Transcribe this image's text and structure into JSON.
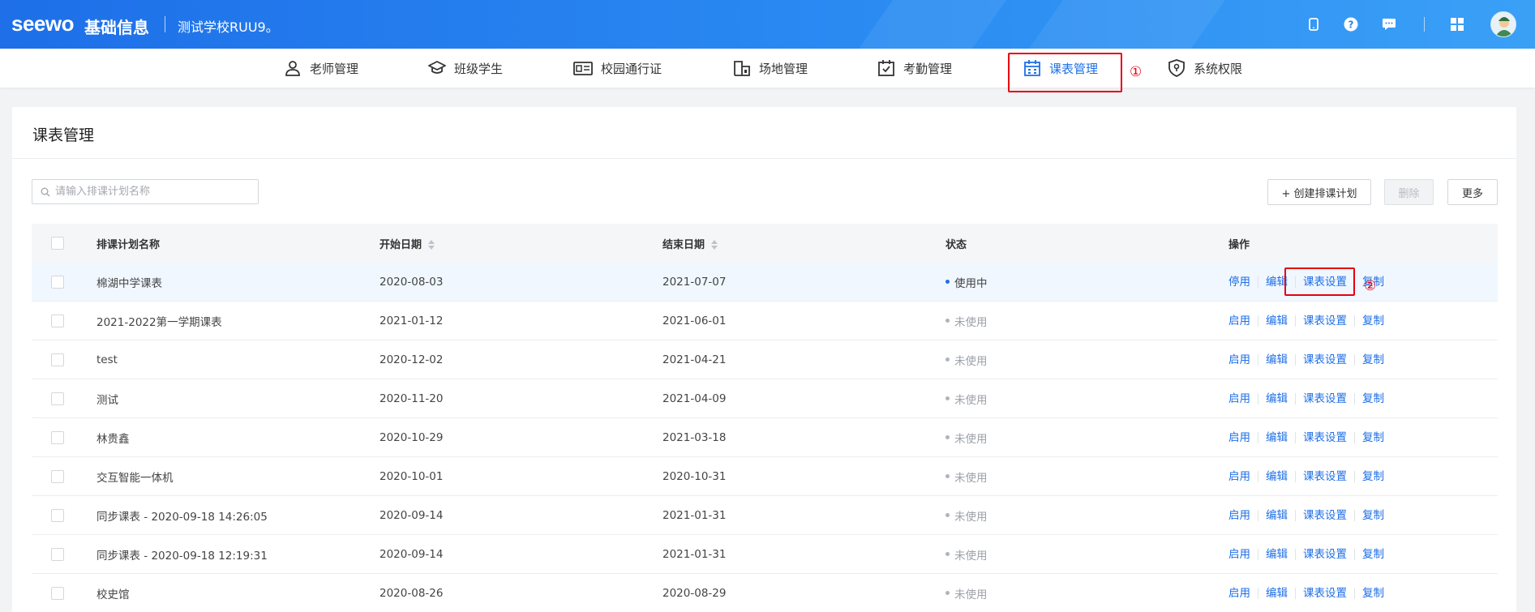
{
  "header": {
    "logo": "seewo",
    "app_title": "基础信息",
    "school_name": "测试学校RUU9。",
    "icons": [
      "phone-icon",
      "help-icon",
      "message-icon",
      "apps-icon",
      "avatar"
    ]
  },
  "nav": {
    "items": [
      {
        "label": "老师管理",
        "icon": "user-icon"
      },
      {
        "label": "班级学生",
        "icon": "graduation-cap-icon"
      },
      {
        "label": "校园通行证",
        "icon": "id-card-icon"
      },
      {
        "label": "场地管理",
        "icon": "building-icon"
      },
      {
        "label": "考勤管理",
        "icon": "calendar-check-icon"
      },
      {
        "label": "课表管理",
        "icon": "calendar-icon",
        "active": true
      },
      {
        "label": "系统权限",
        "icon": "shield-icon"
      }
    ]
  },
  "annotations": {
    "marker_1": "①",
    "marker_2": "②"
  },
  "page": {
    "title": "课表管理",
    "search_placeholder": "请输入排课计划名称",
    "buttons": {
      "create": "+ 创建排课计划",
      "delete": "删除",
      "more": "更多"
    }
  },
  "table": {
    "columns": [
      "排课计划名称",
      "开始日期",
      "结束日期",
      "状态",
      "操作"
    ],
    "rows": [
      {
        "name": "棉湖中学课表",
        "start": "2020-08-03",
        "end": "2021-07-07",
        "status": "使用中",
        "active": true,
        "ops": [
          "停用",
          "编辑",
          "课表设置",
          "复制"
        ]
      },
      {
        "name": "2021-2022第一学期课表",
        "start": "2021-01-12",
        "end": "2021-06-01",
        "status": "未使用",
        "active": false,
        "ops": [
          "启用",
          "编辑",
          "课表设置",
          "复制"
        ]
      },
      {
        "name": "test",
        "start": "2020-12-02",
        "end": "2021-04-21",
        "status": "未使用",
        "active": false,
        "ops": [
          "启用",
          "编辑",
          "课表设置",
          "复制"
        ]
      },
      {
        "name": "测试",
        "start": "2020-11-20",
        "end": "2021-04-09",
        "status": "未使用",
        "active": false,
        "ops": [
          "启用",
          "编辑",
          "课表设置",
          "复制"
        ]
      },
      {
        "name": "林贵鑫",
        "start": "2020-10-29",
        "end": "2021-03-18",
        "status": "未使用",
        "active": false,
        "ops": [
          "启用",
          "编辑",
          "课表设置",
          "复制"
        ]
      },
      {
        "name": "交互智能一体机",
        "start": "2020-10-01",
        "end": "2020-10-31",
        "status": "未使用",
        "active": false,
        "ops": [
          "启用",
          "编辑",
          "课表设置",
          "复制"
        ]
      },
      {
        "name": "同步课表 - 2020-09-18 14:26:05",
        "start": "2020-09-14",
        "end": "2021-01-31",
        "status": "未使用",
        "active": false,
        "ops": [
          "启用",
          "编辑",
          "课表设置",
          "复制"
        ]
      },
      {
        "name": "同步课表 - 2020-09-18 12:19:31",
        "start": "2020-09-14",
        "end": "2021-01-31",
        "status": "未使用",
        "active": false,
        "ops": [
          "启用",
          "编辑",
          "课表设置",
          "复制"
        ]
      },
      {
        "name": "校史馆",
        "start": "2020-08-26",
        "end": "2020-08-29",
        "status": "未使用",
        "active": false,
        "ops": [
          "启用",
          "编辑",
          "课表设置",
          "复制"
        ]
      }
    ]
  },
  "colors": {
    "brand": "#1e6fe8",
    "annotation_red": "#e60012"
  }
}
